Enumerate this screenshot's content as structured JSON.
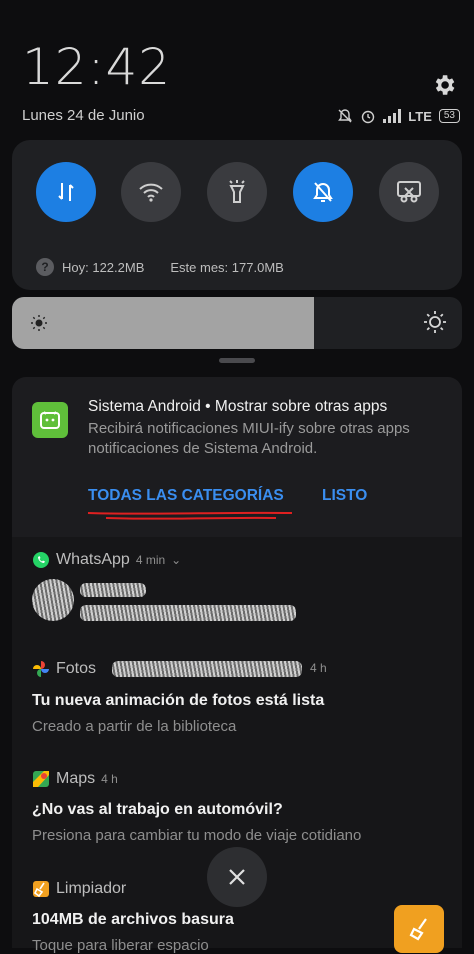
{
  "status": {
    "time": "12:42",
    "date": "Lunes 24 de Junio",
    "network": "LTE",
    "battery": "53"
  },
  "quick_settings": {
    "tiles": [
      {
        "name": "mobile-data",
        "on": true
      },
      {
        "name": "wifi",
        "on": false
      },
      {
        "name": "flashlight",
        "on": false
      },
      {
        "name": "do-not-disturb",
        "on": true
      },
      {
        "name": "screenshot",
        "on": false
      }
    ],
    "data_today": "Hoy: 122.2MB",
    "data_month": "Este mes: 177.0MB"
  },
  "brightness": {
    "level": 0.67
  },
  "system_notification": {
    "title": "Sistema Android • Mostrar sobre otras apps",
    "body": "Recibirá notificaciones MIUI-ify sobre otras apps notificaciones de Sistema Android.",
    "action_all": "TODAS LAS CATEGORÍAS",
    "action_done": "LISTO"
  },
  "notifications": [
    {
      "app": "WhatsApp",
      "time": "4 min"
    },
    {
      "app": "Fotos",
      "time": "4 h",
      "title": "Tu nueva animación de fotos está lista",
      "body": "Creado a partir de la biblioteca"
    },
    {
      "app": "Maps",
      "time": "4 h",
      "title": "¿No vas al trabajo en automóvil?",
      "body": "Presiona para cambiar tu modo de viaje cotidiano"
    },
    {
      "app": "Limpiador",
      "title": "104MB de archivos basura",
      "body": "Toque para liberar espacio"
    }
  ],
  "colors": {
    "accent": "#1d7fe3",
    "link": "#3a8ef0",
    "cleaner": "#f0a020"
  }
}
